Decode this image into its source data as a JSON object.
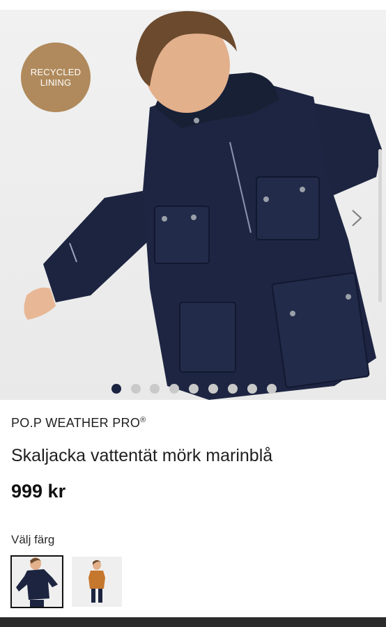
{
  "hero": {
    "image_alt": "Child wearing dark navy hooded rain jacket",
    "badge": {
      "line1": "RECYCLED",
      "line2": "LINING"
    },
    "next_icon": "chevron-right-icon",
    "slide_count": 9,
    "active_slide": 1
  },
  "product": {
    "brand": "PO.P WEATHER PRO",
    "brand_mark": "®",
    "title": "Skaljacka vattentät mörk marinblå",
    "price": "999 kr"
  },
  "color_picker": {
    "label": "Välj färg",
    "options": [
      {
        "color": "#1c2440",
        "selected": true
      },
      {
        "color": "#c6772e",
        "selected": false
      }
    ]
  },
  "colors": {
    "badge": "#b08a5c",
    "navy": "#1c2440",
    "dot_active": "#1a2340",
    "dot_inactive": "#c9c9c9"
  }
}
